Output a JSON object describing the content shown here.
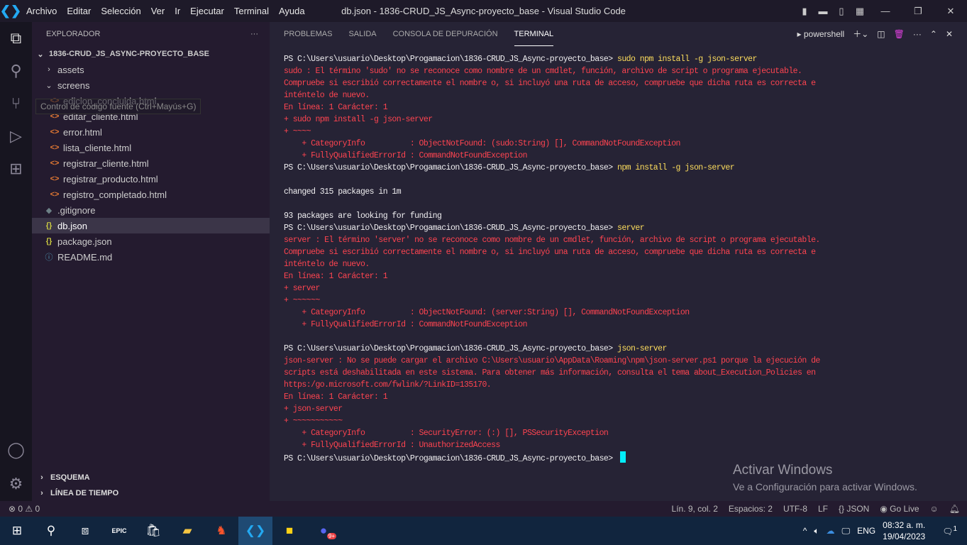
{
  "window": {
    "title": "db.json - 1836-CRUD_JS_Async-proyecto_base - Visual Studio Code",
    "menu": [
      "Archivo",
      "Editar",
      "Selección",
      "Ver",
      "Ir",
      "Ejecutar",
      "Terminal",
      "Ayuda"
    ]
  },
  "sidebar": {
    "title": "EXPLORADOR",
    "more": "···",
    "root": "1836-CRUD_JS_ASYNC-PROYECTO_BASE",
    "items": [
      {
        "label": "assets",
        "type": "folder-closed",
        "depth": 1
      },
      {
        "label": "screens",
        "type": "folder-open",
        "depth": 1
      },
      {
        "label": "edicion_concluida.html",
        "type": "html",
        "depth": 2
      },
      {
        "label": "editar_cliente.html",
        "type": "html",
        "depth": 2
      },
      {
        "label": "error.html",
        "type": "html",
        "depth": 2
      },
      {
        "label": "lista_cliente.html",
        "type": "html",
        "depth": 2
      },
      {
        "label": "registrar_cliente.html",
        "type": "html",
        "depth": 2
      },
      {
        "label": "registrar_producto.html",
        "type": "html",
        "depth": 2
      },
      {
        "label": "registro_completado.html",
        "type": "html",
        "depth": 2
      },
      {
        "label": ".gitignore",
        "type": "git",
        "depth": 1
      },
      {
        "label": "db.json",
        "type": "json",
        "depth": 1,
        "selected": true
      },
      {
        "label": "package.json",
        "type": "json",
        "depth": 1
      },
      {
        "label": "README.md",
        "type": "info",
        "depth": 1
      }
    ],
    "tooltip": "Control de código fuente (Ctrl+Mayús+G)",
    "sections": [
      "ESQUEMA",
      "LÍNEA DE TIEMPO"
    ]
  },
  "panel": {
    "tabs": [
      "PROBLEMAS",
      "SALIDA",
      "CONSOLA DE DEPURACIÓN",
      "TERMINAL"
    ],
    "active_tab": "TERMINAL",
    "shell": "powershell"
  },
  "terminal": {
    "prompt": "PS C:\\Users\\usuario\\Desktop\\Progamacion\\1836-CRUD_JS_Async-proyecto_base> ",
    "lines": [
      {
        "t": "prompt",
        "cmd": "sudo npm install -g json-server"
      },
      {
        "t": "err",
        "text": "sudo : El término 'sudo' no se reconoce como nombre de un cmdlet, función, archivo de script o programa ejecutable."
      },
      {
        "t": "err",
        "text": "Compruebe si escribió correctamente el nombre o, si incluyó una ruta de acceso, compruebe que dicha ruta es correcta e"
      },
      {
        "t": "err",
        "text": "inténtelo de nuevo."
      },
      {
        "t": "err",
        "text": "En línea: 1 Carácter: 1"
      },
      {
        "t": "err",
        "text": "+ sudo npm install -g json-server"
      },
      {
        "t": "err",
        "text": "+ ~~~~"
      },
      {
        "t": "err",
        "text": "    + CategoryInfo          : ObjectNotFound: (sudo:String) [], CommandNotFoundException"
      },
      {
        "t": "err",
        "text": "    + FullyQualifiedErrorId : CommandNotFoundException"
      },
      {
        "t": "prompt",
        "cmd": "npm install -g json-server"
      },
      {
        "t": "out",
        "text": ""
      },
      {
        "t": "out",
        "text": "changed 315 packages in 1m"
      },
      {
        "t": "out",
        "text": ""
      },
      {
        "t": "out",
        "text": "93 packages are looking for funding"
      },
      {
        "t": "prompt",
        "cmd": "server"
      },
      {
        "t": "err",
        "text": "server : El término 'server' no se reconoce como nombre de un cmdlet, función, archivo de script o programa ejecutable."
      },
      {
        "t": "err",
        "text": "Compruebe si escribió correctamente el nombre o, si incluyó una ruta de acceso, compruebe que dicha ruta es correcta e"
      },
      {
        "t": "err",
        "text": "inténtelo de nuevo."
      },
      {
        "t": "err",
        "text": "En línea: 1 Carácter: 1"
      },
      {
        "t": "err",
        "text": "+ server"
      },
      {
        "t": "err",
        "text": "+ ~~~~~~"
      },
      {
        "t": "err",
        "text": "    + CategoryInfo          : ObjectNotFound: (server:String) [], CommandNotFoundException"
      },
      {
        "t": "err",
        "text": "    + FullyQualifiedErrorId : CommandNotFoundException"
      },
      {
        "t": "out",
        "text": ""
      },
      {
        "t": "prompt",
        "cmd": "json-server"
      },
      {
        "t": "err",
        "text": "json-server : No se puede cargar el archivo C:\\Users\\usuario\\AppData\\Roaming\\npm\\json-server.ps1 porque la ejecución de"
      },
      {
        "t": "err",
        "text": "scripts está deshabilitada en este sistema. Para obtener más información, consulta el tema about_Execution_Policies en"
      },
      {
        "t": "err",
        "text": "https:/go.microsoft.com/fwlink/?LinkID=135170."
      },
      {
        "t": "err",
        "text": "En línea: 1 Carácter: 1"
      },
      {
        "t": "err",
        "text": "+ json-server"
      },
      {
        "t": "err",
        "text": "+ ~~~~~~~~~~~"
      },
      {
        "t": "err",
        "text": "    + CategoryInfo          : SecurityError: (:) [], PSSecurityException"
      },
      {
        "t": "err",
        "text": "    + FullyQualifiedErrorId : UnauthorizedAccess"
      },
      {
        "t": "prompt",
        "cmd": "",
        "cursor": true
      }
    ]
  },
  "watermark": {
    "line1": "Activar Windows",
    "line2": "Ve a Configuración para activar Windows."
  },
  "status": {
    "errors": "0",
    "warnings": "0",
    "position": "Lín. 9, col. 2",
    "spaces": "Espacios: 2",
    "encoding": "UTF-8",
    "eol": "LF",
    "language": "JSON",
    "golive": "Go Live"
  },
  "taskbar": {
    "lang": "ENG",
    "time": "08:32 a. m.",
    "date": "19/04/2023",
    "notifications": "1",
    "discord_badge": "9+"
  },
  "colors": {
    "error": "#fe4450",
    "command": "#fede5d",
    "cursor": "#03edf9"
  }
}
